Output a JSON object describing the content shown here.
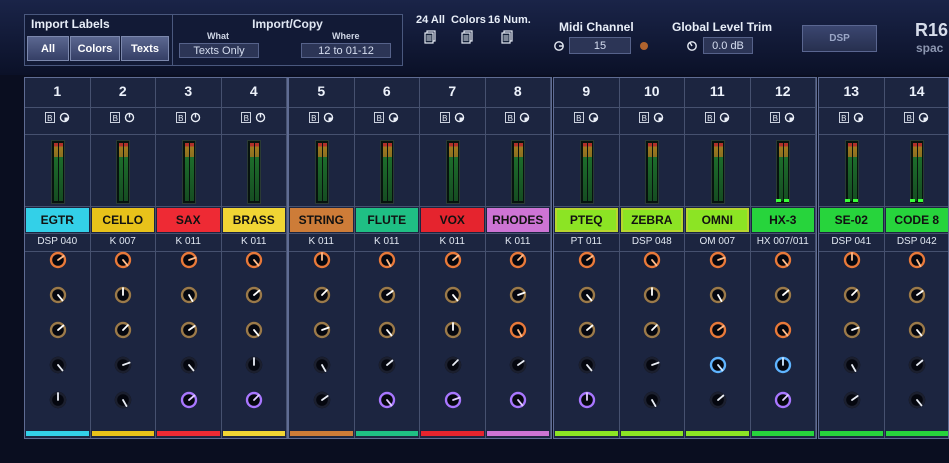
{
  "top": {
    "import_labels": {
      "title": "Import Labels",
      "buttons": [
        "All",
        "Colors",
        "Texts"
      ]
    },
    "import_copy": {
      "title": "Import/Copy",
      "what_label": "What",
      "what_value": "Texts Only",
      "where_label": "Where",
      "where_value": "12 to 01-12"
    },
    "count_labels": [
      "24 All",
      "Colors",
      "16 Num."
    ],
    "midi": {
      "label": "Midi Channel",
      "value": "15"
    },
    "trim": {
      "label": "Global Level Trim",
      "value": "0.0 dB"
    },
    "dsp_label": "DSP",
    "model": "R16",
    "model_sub": "spac"
  },
  "theme": {
    "knob_orange": "#e8793a",
    "knob_purple": "#a877ff",
    "knob_blue": "#5fb4ff",
    "knob_bronze": "#9b7a4a",
    "knob_dark": "#1b1f2e"
  },
  "groups": [
    {
      "channels": [
        {
          "num": "1",
          "label": "EGTR",
          "color": "#33d0e8",
          "preset": "DSP 040",
          "knobs": [
            "orange",
            "bronze",
            "bronze",
            "dark",
            "dark"
          ],
          "ind": "half",
          "leds": false,
          "framed": false
        },
        {
          "num": "2",
          "label": "CELLO",
          "color": "#e8c21a",
          "preset": "K 007",
          "knobs": [
            "orange",
            "bronze",
            "bronze",
            "dark",
            "dark"
          ],
          "ind": "ring",
          "leds": false,
          "framed": false
        },
        {
          "num": "3",
          "label": "SAX",
          "color": "#ee2a34",
          "preset": "K 011",
          "knobs": [
            "orange",
            "bronze",
            "bronze",
            "dark",
            "purple"
          ],
          "ind": "ring",
          "leds": false,
          "framed": false
        },
        {
          "num": "4",
          "label": "BRASS",
          "color": "#f0d534",
          "preset": "K 011",
          "knobs": [
            "orange",
            "bronze",
            "bronze",
            "dark",
            "purple"
          ],
          "ind": "ring",
          "leds": false,
          "framed": false
        }
      ]
    },
    {
      "channels": [
        {
          "num": "5",
          "label": "STRING",
          "color": "#cd7c38",
          "preset": "K 011",
          "knobs": [
            "orange",
            "bronze",
            "bronze",
            "dark",
            "dark"
          ],
          "ind": "half",
          "leds": false,
          "framed": false
        },
        {
          "num": "6",
          "label": "FLUTE",
          "color": "#1fbf84",
          "preset": "K 011",
          "knobs": [
            "orange",
            "bronze",
            "bronze",
            "dark",
            "purple"
          ],
          "ind": "half",
          "leds": false,
          "framed": false
        },
        {
          "num": "7",
          "label": "VOX",
          "color": "#e5242e",
          "preset": "K 011",
          "knobs": [
            "orange",
            "bronze",
            "bronze",
            "dark",
            "purple"
          ],
          "ind": "half",
          "leds": false,
          "framed": false
        },
        {
          "num": "8",
          "label": "RHODES",
          "color": "#cd74d4",
          "preset": "K 011",
          "knobs": [
            "orange",
            "bronze",
            "orange",
            "dark",
            "purple"
          ],
          "ind": "half",
          "leds": false,
          "framed": false
        }
      ]
    },
    {
      "channels": [
        {
          "num": "9",
          "label": "PTEQ",
          "color": "#8ce424",
          "preset": "PT 011",
          "knobs": [
            "orange",
            "bronze",
            "bronze",
            "dark",
            "purple"
          ],
          "ind": "half",
          "leds": false,
          "framed": true
        },
        {
          "num": "10",
          "label": "ZEBRA",
          "color": "#8ce424",
          "preset": "DSP 048",
          "knobs": [
            "orange",
            "bronze",
            "bronze",
            "dark",
            "dark"
          ],
          "ind": "half",
          "leds": false,
          "framed": true
        },
        {
          "num": "11",
          "label": "OMNI",
          "color": "#8ce424",
          "preset": "OM 007",
          "knobs": [
            "orange",
            "bronze",
            "orange",
            "blue",
            "dark"
          ],
          "ind": "half",
          "leds": false,
          "framed": true
        },
        {
          "num": "12",
          "label": "HX-3",
          "color": "#27d43c",
          "preset": "HX 007/011",
          "knobs": [
            "orange",
            "bronze",
            "orange",
            "blue",
            "purple"
          ],
          "ind": "half",
          "leds": true,
          "framed": false
        }
      ]
    },
    {
      "channels": [
        {
          "num": "13",
          "label": "SE-02",
          "color": "#27d43c",
          "preset": "DSP 041",
          "knobs": [
            "orange",
            "bronze",
            "bronze",
            "dark",
            "dark"
          ],
          "ind": "half",
          "leds": true,
          "framed": false
        },
        {
          "num": "14",
          "label": "CODE 8",
          "color": "#27d43c",
          "preset": "DSP 042",
          "knobs": [
            "orange",
            "bronze",
            "bronze",
            "dark",
            "dark"
          ],
          "ind": "half",
          "leds": true,
          "framed": false
        }
      ]
    }
  ]
}
